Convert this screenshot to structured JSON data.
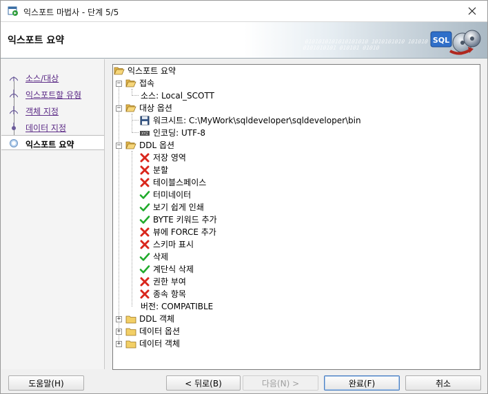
{
  "window": {
    "title": "익스포트 마법사 - 단계 5/5"
  },
  "banner": {
    "title": "익스포트 요약",
    "binary_text": "0101010101010101010 1010101010 101010 0101010101 010101 01010",
    "graphic_label": "SQL"
  },
  "nav": {
    "items": [
      {
        "label": "소스/대상",
        "state": "link"
      },
      {
        "label": "익스포트할 유형",
        "state": "link"
      },
      {
        "label": "객체 지정",
        "state": "link"
      },
      {
        "label": "데이터 지정",
        "state": "link"
      },
      {
        "label": "익스포트 요약",
        "state": "current"
      }
    ]
  },
  "tree": {
    "root": "익스포트 요약",
    "connection": {
      "label": "접속",
      "source": "소스: Local_SCOTT"
    },
    "target": {
      "label": "대상 옵션",
      "worksheet": "워크시트: C:\\MyWork\\sqldeveloper\\sqldeveloper\\bin",
      "encoding": "인코딩: UTF-8"
    },
    "ddl_options": {
      "label": "DDL 옵션",
      "items": [
        {
          "label": "저장 영역",
          "enabled": false
        },
        {
          "label": "분할",
          "enabled": false
        },
        {
          "label": "테이블스페이스",
          "enabled": false
        },
        {
          "label": "터미네이터",
          "enabled": true
        },
        {
          "label": "보기 쉽게 인쇄",
          "enabled": true
        },
        {
          "label": "BYTE 키워드 추가",
          "enabled": true
        },
        {
          "label": "뷰에 FORCE 추가",
          "enabled": false
        },
        {
          "label": "스키마 표시",
          "enabled": false
        },
        {
          "label": "삭제",
          "enabled": true
        },
        {
          "label": "계단식 삭제",
          "enabled": true
        },
        {
          "label": "권한 부여",
          "enabled": false
        },
        {
          "label": "종속 항목",
          "enabled": false
        }
      ],
      "version": "버전: COMPATIBLE"
    },
    "collapsed": [
      "DDL 객체",
      "데이터 옵션",
      "데이터 객체"
    ]
  },
  "buttons": {
    "help": "도움말(H)",
    "back": "< 뒤로(B)",
    "next": "다음(N) >",
    "finish": "완료(F)",
    "cancel": "취소"
  },
  "colors": {
    "link": "#5b2a86",
    "check": "#1faa2a",
    "cross": "#d9261c",
    "folder": "#e8c25a"
  }
}
